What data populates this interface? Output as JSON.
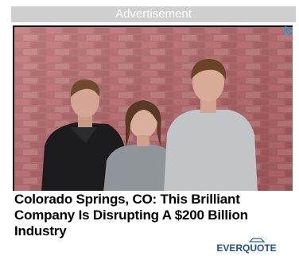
{
  "header": {
    "label": "Advertisement"
  },
  "ad": {
    "headline": "Colorado Springs, CO: This Brilliant Company Is Disrupting A $200 Billion Industry",
    "brand": "EVERQUOTE",
    "adchoices_icon": "adchoices-icon"
  }
}
